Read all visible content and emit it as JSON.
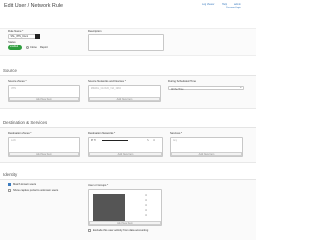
{
  "header": {
    "title": "Edit User / Network Rule",
    "links": [
      "Log Viewer",
      "Help",
      "admin"
    ],
    "sub_link": "Password login"
  },
  "rule": {
    "name_label": "Rule Name *",
    "name_value": "SSL_VPN_Client",
    "status_label": "Status",
    "status_value": "enabled",
    "clone_label": "Clone",
    "report_label": "Report",
    "description_label": "Description"
  },
  "source": {
    "heading": "Source",
    "zones_label": "Source Zones *",
    "zones_value": "VPN",
    "networks_label": "Source Networks and Devices *",
    "networks_value": "##MAIL_CLOUD_VIA_1984",
    "time_label": "During Scheduled Time",
    "time_value": "All the Time",
    "add_label": "Add New Item"
  },
  "destination": {
    "heading": "Destination & Services",
    "zones_label": "Destination Zones *",
    "zones_value": "LAN",
    "networks_label": "Destination Networks *",
    "networks_value": "IP H",
    "services_label": "Services *",
    "services_value": "Any",
    "add_label": "Add New Item"
  },
  "identity": {
    "heading": "Identity",
    "match_known": "Match known users",
    "captive_portal": "Show captive portal to unknown users",
    "groups_label": "User or Groups *",
    "exclude_label": "Exclude this user activity from data accounting",
    "add_label": "Add New Item"
  },
  "colors": {
    "accent": "#3a7bbf",
    "toggle": "#2e9e3e",
    "redacted": "#222222",
    "redacted_box": "#555555"
  }
}
